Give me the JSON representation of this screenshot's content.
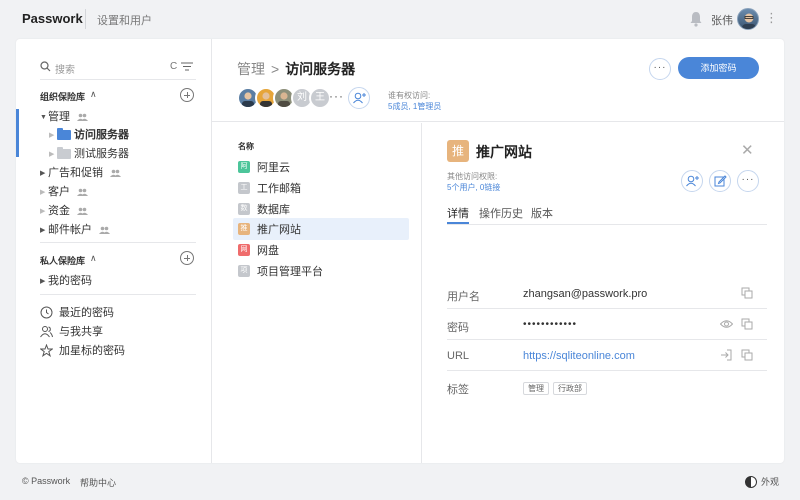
{
  "topbar": {
    "logo": "Passwork",
    "section": "设置和用户",
    "user_name": "张伟"
  },
  "sidebar": {
    "search_placeholder": "搜索",
    "search_shortcut": "C",
    "org_vault_title": "组织保险库",
    "org_tree": [
      {
        "label": "管理"
      },
      {
        "label": "访问服务器"
      },
      {
        "label": "测试服务器"
      },
      {
        "label": "广告和促销"
      },
      {
        "label": "客户"
      },
      {
        "label": "资金"
      },
      {
        "label": "邮件帐户"
      }
    ],
    "private_vault_title": "私人保险库",
    "private_tree": [
      {
        "label": "我的密码"
      }
    ],
    "menu": [
      {
        "label": "最近的密码",
        "icon": "clock-icon"
      },
      {
        "label": "与我共享",
        "icon": "users-icon"
      },
      {
        "label": "加星标的密码",
        "icon": "star-icon"
      }
    ]
  },
  "header": {
    "breadcrumb_parent": "管理",
    "breadcrumb_current": "访问服务器",
    "avatar_letters": [
      "刘",
      "王"
    ],
    "access_label": "谁有权访问:",
    "access_value": "5成员, 1管理员",
    "add_password_label": "添加密码"
  },
  "list": {
    "column_header": "名称",
    "items": [
      {
        "label": "阿里云",
        "badge": "阿",
        "color": "#4cc59a"
      },
      {
        "label": "工作邮箱",
        "badge": "工",
        "color": "#c4c7cc"
      },
      {
        "label": "数据库",
        "badge": "数",
        "color": "#c4c7cc"
      },
      {
        "label": "推广网站",
        "badge": "推",
        "color": "#e7b47d",
        "selected": true
      },
      {
        "label": "网盘",
        "badge": "网",
        "color": "#ef6c6c"
      },
      {
        "label": "项目管理平台",
        "badge": "项",
        "color": "#c4c7cc"
      }
    ]
  },
  "detail": {
    "icon_letter": "推",
    "title": "推广网站",
    "access_label": "其他访问权限:",
    "access_value": "5个用户, 0链接",
    "tabs": [
      "详情",
      "操作历史",
      "版本"
    ],
    "fields": {
      "username_label": "用户名",
      "username_value": "zhangsan@passwork.pro",
      "password_label": "密码",
      "password_value": "••••••••••••",
      "url_label": "URL",
      "url_value": "https://sqliteonline.com",
      "tags_label": "标签",
      "tags": [
        "管理",
        "行政部"
      ]
    }
  },
  "footer": {
    "copyright": "© Passwork",
    "help": "帮助中心",
    "appearance": "外观"
  }
}
